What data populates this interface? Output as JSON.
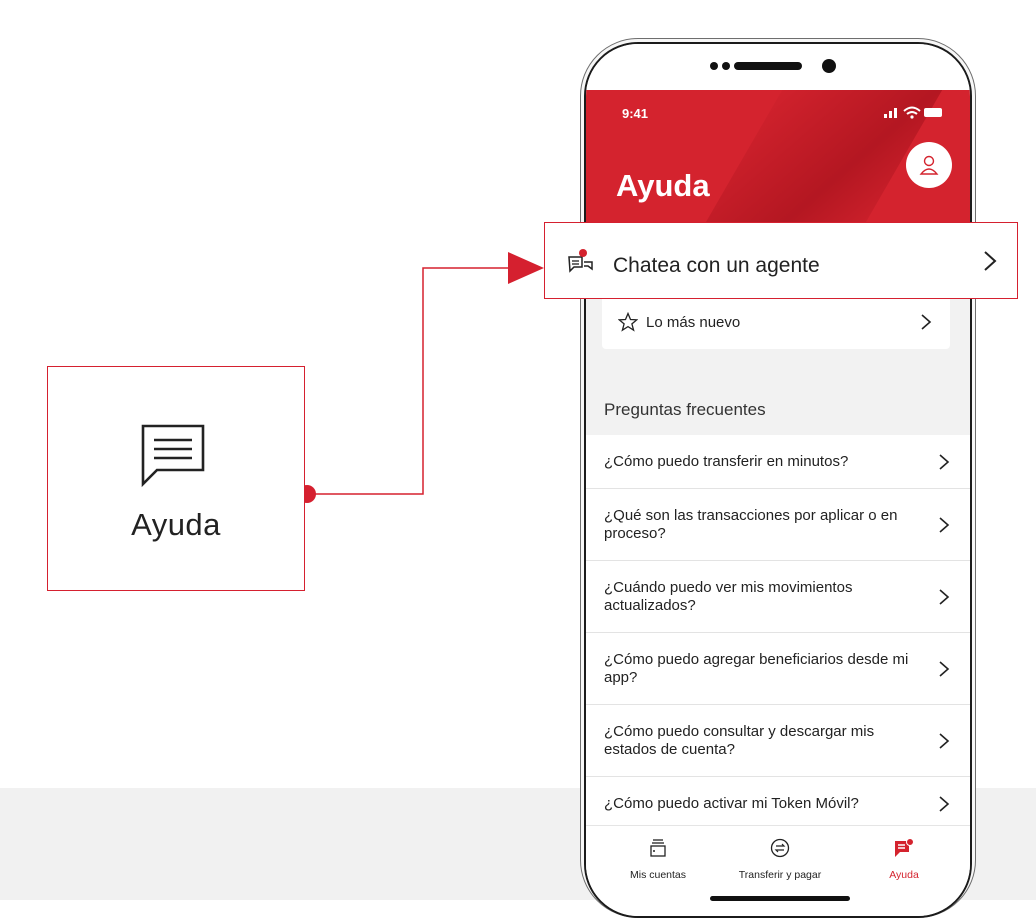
{
  "callout": {
    "label": "Ayuda",
    "icon": "chat-lines-icon"
  },
  "phone": {
    "status_time": "9:41",
    "header_title": "Ayuda",
    "chat_row": {
      "label": "Chatea con un agente",
      "icon": "agent-chat-icon"
    },
    "news_row": {
      "label": "Lo más nuevo",
      "icon": "star-icon"
    },
    "faq": {
      "title": "Preguntas frecuentes",
      "items": [
        {
          "text": "¿Cómo puedo transferir en minutos?"
        },
        {
          "text": "¿Qué son las transacciones por aplicar o en proceso?"
        },
        {
          "text": "¿Cuándo puedo ver mis movimientos actualizados?"
        },
        {
          "text": "¿Cómo puedo agregar beneficiarios desde mi app?"
        },
        {
          "text": "¿Cómo puedo consultar y descargar mis estados de cuenta?"
        },
        {
          "text": "¿Cómo puedo activar mi Token Móvil?"
        }
      ]
    },
    "tabs": [
      {
        "label": "Mis cuentas",
        "icon": "wallet-icon",
        "active": false
      },
      {
        "label": "Transferir y pagar",
        "icon": "transfer-icon",
        "active": false
      },
      {
        "label": "Ayuda",
        "icon": "help-chat-icon",
        "active": true
      }
    ]
  },
  "colors": {
    "brand_red": "#d4232e",
    "text": "#222222",
    "background_gray": "#f2f2f2"
  }
}
